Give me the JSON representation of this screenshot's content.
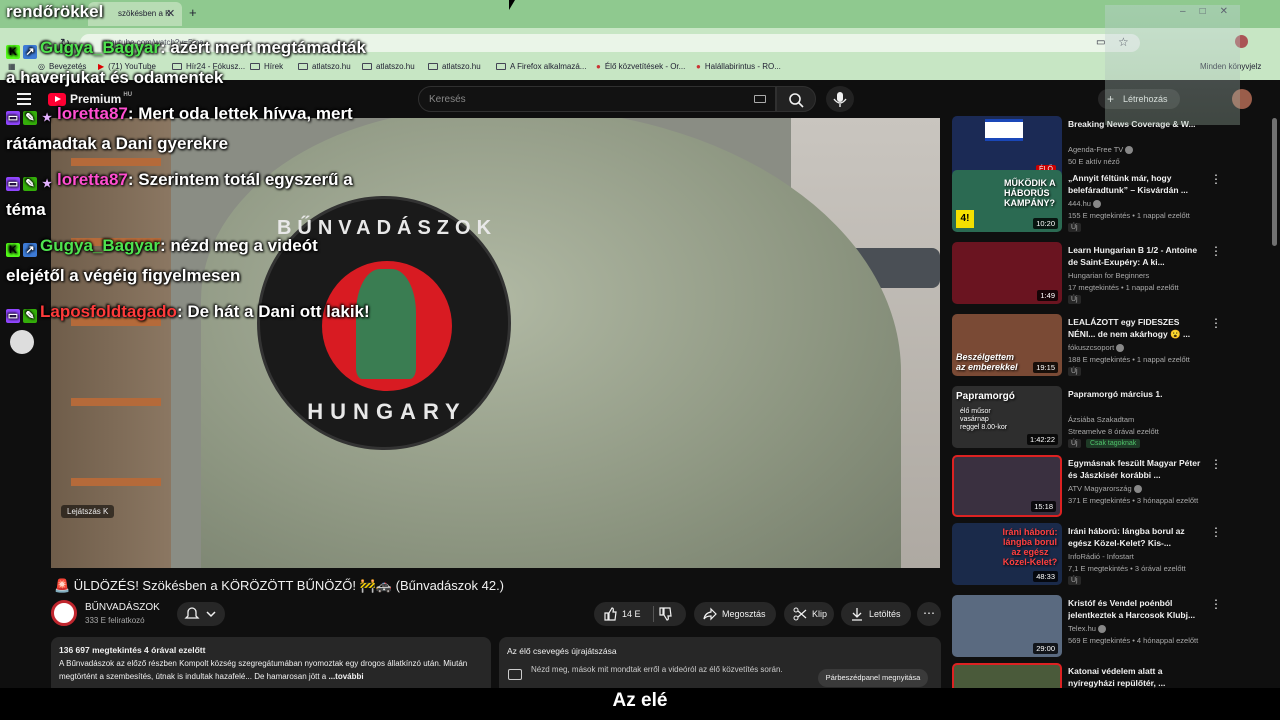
{
  "browser": {
    "tab_title": "szökésben a K",
    "url": "youtube.com/watch?v=5ma...",
    "bookmarks": [
      "Bevezetés",
      "(71) YouTube",
      "Hír24 - Fókusz...",
      "Hírek",
      "atlatszo.hu",
      "atlatszo.hu",
      "atlatszo.hu",
      "A Firefox alkalmazá...",
      "Élő közvetítések - Or...",
      "Halállabirintus - RO..."
    ],
    "other_bookmarks": "Minden könyvjelz"
  },
  "youtube": {
    "logo": "Premium",
    "region": "HU",
    "search_placeholder": "Keresés",
    "create_label": "Létrehozás"
  },
  "video": {
    "patch_top": "BŰNVADÁSZOK",
    "patch_bottom": "HUNGARY",
    "skip_label": "Lejátszás  K",
    "title": "🚨 ÜLDÖZÉS! Szökésben a KÖRÖZÖTT BŰNÖZŐ! 🚧🚓 (Bűnvadászok 42.)",
    "channel_name": "BŰNVADÁSZOK",
    "subscribers": "333 E feliratkozó",
    "likes": "14 E",
    "share": "Megosztás",
    "clip": "Klip",
    "download": "Letöltés"
  },
  "description": {
    "stats": "136 697 megtekintés  4 órával ezelőtt",
    "text": "A Bűnvadászok az előző részben Kompolt község szegregátumában nyomoztak egy drogos állatkínzó után. Miután megtörtént a szembesítés, útnak is indultak hazafelé... De hamarosan jött a",
    "more": "...további"
  },
  "chat_replay": {
    "title": "Az élő csevegés újrajátszása",
    "text": "Nézd meg, mások mit mondtak erről a videóról az élő közvetítés során.",
    "button": "Párbeszédpanel megnyitása"
  },
  "recommendations": [
    {
      "title": "Breaking News Coverage & W...",
      "channel": "Agenda-Free TV",
      "meta": "50 E aktív néző",
      "duration": "",
      "badge": "",
      "thumb_color": "#1b2a55"
    },
    {
      "title": "„Annyit féltünk már, hogy belefáradtunk” – Kisvárdán ...",
      "channel": "444.hu",
      "meta": "155 E megtekintés • 1 nappal ezelőtt",
      "duration": "10:20",
      "badge": "Új",
      "thumb_color": "#2b6a52"
    },
    {
      "title": "Learn Hungarian B 1/2 - Antoine de Saint-Exupéry: A ki...",
      "channel": "Hungarian for Beginners",
      "meta": "17 megtekintés • 1 nappal ezelőtt",
      "duration": "1:49",
      "badge": "Új",
      "thumb_color": "#6a1420"
    },
    {
      "title": "LEALÁZOTT egy FIDESZES NÉNI... de nem akárhogy 😮 ...",
      "channel": "fókuszcsoport",
      "meta": "188 E megtekintés • 1 nappal ezelőtt",
      "duration": "19:15",
      "badge": "Új",
      "thumb_color": "#7a4a35"
    },
    {
      "title": "Papramorgó március 1.",
      "channel": "Ázsiába Szakadtam",
      "meta": "Streamelve 8 órával ezelőtt",
      "duration": "1:42:22",
      "badge": "Új",
      "thumb_color": "#2e2e2e"
    },
    {
      "title": "Egymásnak feszült Magyar Péter és Jászkisér korábbi ...",
      "channel": "ATV Magyarország",
      "meta": "371 E megtekintés • 3 hónappal ezelőtt",
      "duration": "15:18",
      "badge": "",
      "thumb_color": "#3a3040"
    },
    {
      "title": "Iráni háború: lángba borul az egész Közel-Kelet? Kis-...",
      "channel": "InfoRádió - Infostart",
      "meta": "7,1 E megtekintés • 3 órával ezelőtt",
      "duration": "48:33",
      "badge": "Új",
      "thumb_color": "#1a2a4a"
    },
    {
      "title": "Kristóf és Vendel poénból jelentkeztek a Harcosok Klubj...",
      "channel": "Telex.hu",
      "meta": "569 E megtekintés • 4 hónappal ezelőtt",
      "duration": "29:00",
      "badge": "",
      "thumb_color": "#5a6a80"
    },
    {
      "title": "Katonai védelem alatt a nyíregyházi repülőtér, ...",
      "channel": "",
      "meta": "",
      "duration": "",
      "badge": "",
      "thumb_color": "#4a5a3a"
    }
  ],
  "rec_extra": {
    "live_badge": "ÉLŐ",
    "members_only": "Csak tagoknak",
    "thumb_texts": [
      "MŰKÖDIK A HÁBORÚS KAMPÁNY?",
      "Beszélgettem az emberekkel",
      "Papramorgó",
      "élő műsor vasárnap reggel 8.00-kor",
      "Iráni háború: lángba borul az egész Közel-Kelet?"
    ]
  },
  "overlay_chat": {
    "top_caption": "rendőrökkel",
    "messages": [
      {
        "user": "Gugya_Bagyar",
        "text": ": azért mert megtámadták",
        "cont": "a haverjukat és odamentek"
      },
      {
        "user": "loretta87",
        "text": ": Mert oda lettek hívva, mert",
        "cont": "rátámadtak a Dani gyerekre"
      },
      {
        "user": "loretta87",
        "text": ": Szerintem totál egyszerű a",
        "cont": "téma"
      },
      {
        "user": "Gugya_Bagyar",
        "text": ": nézd meg a videót",
        "cont": "elejétől a végéig figyelmesen"
      },
      {
        "user": "Laposfoldtagado",
        "text": ": De hát a Dani ott lakik!",
        "cont": ""
      }
    ]
  },
  "subtitle": "Az elé"
}
